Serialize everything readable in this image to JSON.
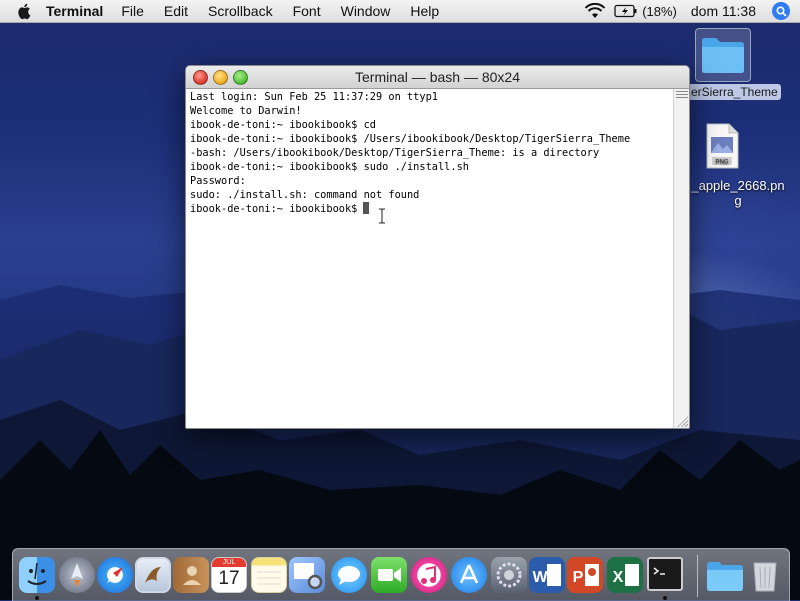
{
  "menubar": {
    "app": "Terminal",
    "items": [
      "File",
      "Edit",
      "Scrollback",
      "Font",
      "Window",
      "Help"
    ],
    "battery": "(18%)",
    "clock": "dom 11:38"
  },
  "desktop": {
    "folder_label": "erSierra_Theme",
    "png_badge": "PNG",
    "png_label_1": "_apple_2668.pn",
    "png_label_2": "g"
  },
  "terminal": {
    "title": "Terminal — bash — 80x24",
    "lines": [
      "Last login: Sun Feb 25 11:37:29 on ttyp1",
      "Welcome to Darwin!",
      "ibook-de-toni:~ ibookibook$ cd",
      "ibook-de-toni:~ ibookibook$ /Users/ibookibook/Desktop/TigerSierra_Theme",
      "-bash: /Users/ibookibook/Desktop/TigerSierra_Theme: is a directory",
      "ibook-de-toni:~ ibookibook$ sudo ./install.sh",
      "Password:",
      "sudo: ./install.sh: command not found",
      "ibook-de-toni:~ ibookibook$"
    ]
  },
  "dock": {
    "calendar_month": "JUL",
    "calendar_day": "17",
    "apps": [
      "finder-icon",
      "launchpad-icon",
      "safari-icon",
      "mail-icon",
      "contacts-icon",
      "calendar-icon",
      "notes-icon",
      "preview-icon",
      "messages-icon",
      "facetime-icon",
      "itunes-icon",
      "app-store-icon",
      "system-preferences-icon",
      "word-icon",
      "powerpoint-icon",
      "excel-icon",
      "terminal-icon",
      "downloads-folder-icon",
      "trash-icon"
    ]
  }
}
